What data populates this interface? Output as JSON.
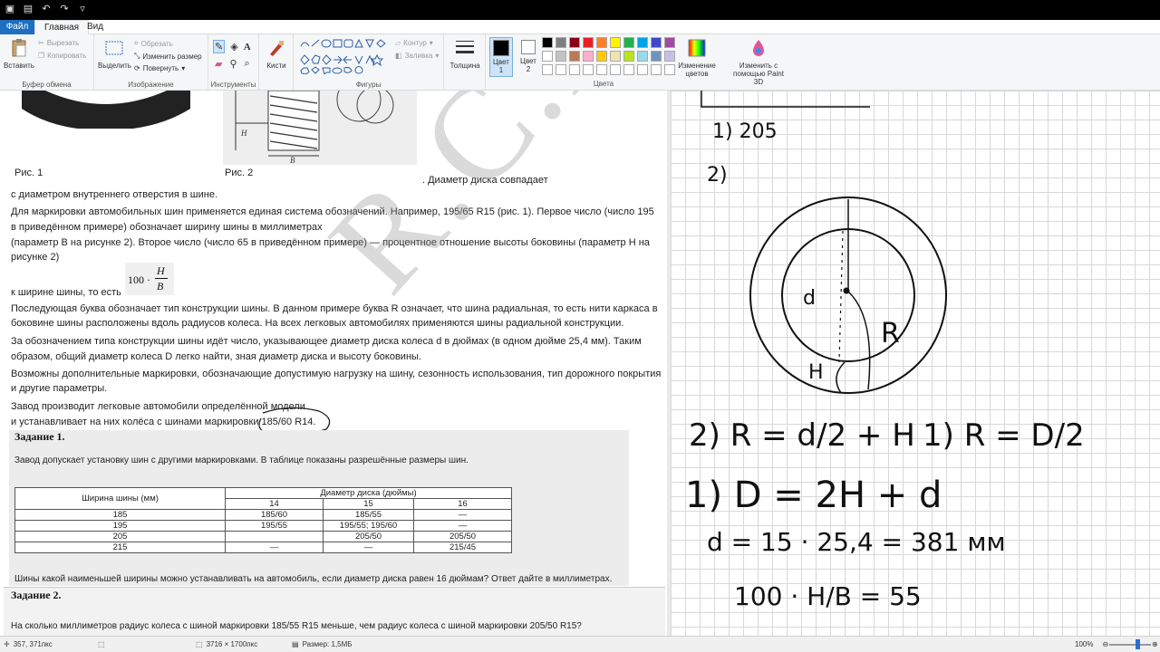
{
  "tabs": {
    "file": "Файл",
    "home": "Главная",
    "view": "Вид"
  },
  "ribbon": {
    "clipboard": {
      "paste": "Вставить",
      "cut": "Вырезать",
      "copy": "Копировать",
      "label": "Буфер обмена"
    },
    "image": {
      "select": "Выделить",
      "crop": "Обрезать",
      "resize": "Изменить размер",
      "rotate": "Повернуть",
      "label": "Изображение"
    },
    "tools": {
      "label": "Инструменты"
    },
    "brushes": {
      "label": "Кисти"
    },
    "shapes": {
      "outline": "Контур",
      "fill": "Заливка",
      "label": "Фигуры"
    },
    "size": {
      "label": "Толщина"
    },
    "color1": {
      "label": "Цвет 1"
    },
    "color2": {
      "label": "Цвет 2"
    },
    "colors": {
      "label": "Цвета",
      "edit": "Изменение цветов"
    },
    "paint3d": {
      "label": "Изменить с помощью Paint 3D"
    }
  },
  "palette": [
    "#000000",
    "#7f7f7f",
    "#880015",
    "#ed1c24",
    "#ff7f27",
    "#fff200",
    "#22b14c",
    "#00a2e8",
    "#3f48cc",
    "#a349a4",
    "#ffffff",
    "#c3c3c3",
    "#b97a57",
    "#ffaec9",
    "#ffc90e",
    "#efe4b0",
    "#b5e61d",
    "#99d9ea",
    "#7092be",
    "#c8bfe7",
    "#ffffff",
    "#ffffff",
    "#ffffff",
    "#ffffff",
    "#ffffff",
    "#ffffff",
    "#ffffff",
    "#ffffff",
    "#ffffff",
    "#ffffff"
  ],
  "doc": {
    "fig1": "Рис. 1",
    "fig2": "Рис. 2",
    "line0": ". Диаметр диска совпадает",
    "line1": "с диаметром внутреннего отверстия в шине.",
    "line2": "Для маркировки автомобильных шин применяется единая система обозначений. Например, 195/65 R15 (рис. 1). Первое число (число 195",
    "line3": "в приведённом примере) обозначает ширину шины в миллиметрах",
    "line4": "(параметр B на рисунке 2). Второе число (число 65 в приведённом примере) — процентное отношение высоты боковины (параметр H на",
    "line5": "рисунке 2)",
    "line6": "к ширине шины, то есть",
    "formula": "100 · H/B",
    "line7": "Последующая буква обозначает тип конструкции шины. В данном примере буква R означает, что шина радиальная, то есть нити каркаса в",
    "line8": "боковине шины расположены вдоль радиусов колеса. На всех легковых автомобилях применяются шины радиальной конструкции.",
    "line9": "За обозначением типа конструкции шины идёт число, указывающее диаметр диска колеса d в дюймах (в одном дюйме 25,4 мм). Таким",
    "line10": "образом, общий диаметр колеса D легко найти, зная диаметр диска и высоту боковины.",
    "line11": "Возможны дополнительные маркировки, обозначающие допустимую нагрузку на шину, сезонность использования, тип дорожного покрытия",
    "line12": "и другие параметры.",
    "line13": "Завод производит легковые автомобили определённой модели",
    "line14": "и устанавливает на них колёса с шинами маркировки 185/60 R14.",
    "task1_title": "Задание 1.",
    "task1_text": "Завод допускает установку шин с другими маркировками. В таблице показаны разрешённые размеры шин.",
    "task1_question": "Шины какой наименьшей ширины можно устанавливать на автомобиль, если диаметр диска равен 16 дюймам? Ответ дайте в миллиметрах.",
    "task2_title": "Задание 2.",
    "task2_text": "На сколько миллиметров радиус колеса с шиной маркировки 185/55 R15 меньше, чем радиус колеса с шиной маркировки 205/50 R15?",
    "watermark": "R.C.H."
  },
  "table": {
    "col_width": "Ширина шины (мм)",
    "col_diam": "Диаметр диска (дюймы)",
    "diams": [
      "14",
      "15",
      "16"
    ],
    "rows": [
      {
        "w": "185",
        "c": [
          "185/60",
          "185/55",
          "—"
        ]
      },
      {
        "w": "195",
        "c": [
          "195/55",
          "195/55; 195/60",
          "—"
        ]
      },
      {
        "w": "205",
        "c": [
          "",
          "205/50",
          "205/50"
        ]
      },
      {
        "w": "215",
        "c": [
          "—",
          "—",
          "215/45"
        ]
      }
    ]
  },
  "handwriting": {
    "a1": "1) 205",
    "a2": "2)",
    "eq1": "2) R = d/2 + H",
    "eq2": "1) R = D/2",
    "eq3": "1) D = 2H + d",
    "eq4": "d = 15 · 25,4 = 381 мм",
    "eq5": "100 · H/B = 55",
    "lbl_d": "d",
    "lbl_R": "R",
    "lbl_H": "H"
  },
  "status": {
    "cursor": "357, 371пкс",
    "dimensions": "3716 × 1700пкс",
    "filesize": "Размер: 1,5МБ",
    "zoom": "100%"
  }
}
